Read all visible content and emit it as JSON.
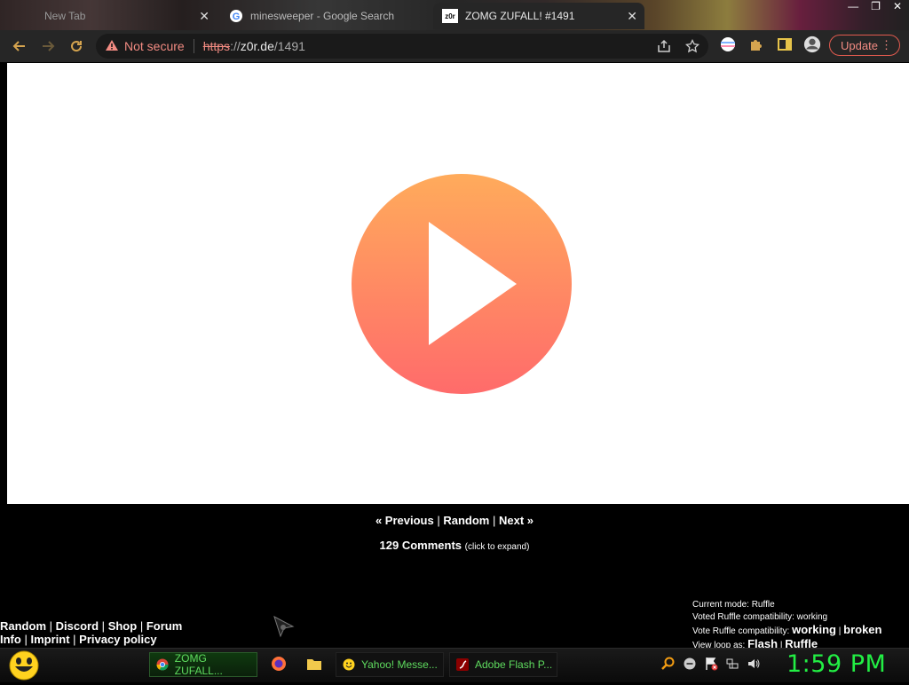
{
  "browser": {
    "tabs": [
      {
        "title": "New Tab",
        "active": false
      },
      {
        "title": "minesweeper - Google Search",
        "active": false
      },
      {
        "title": "ZOMG ZUFALL! #1491",
        "active": true
      }
    ],
    "new_tab_close": "×",
    "security_label": "Not secure",
    "url_scheme": "https",
    "url_rest": "://z0r.de/1491",
    "url_host": "z0r.de",
    "url_path": "/1491",
    "update_label": "Update",
    "favicon_text": "z0r"
  },
  "page": {
    "nav": {
      "previous": "« Previous",
      "random": "Random",
      "next": "Next »",
      "sep": "|"
    },
    "comments": {
      "count": "129 Comments",
      "hint": "(click to expand)"
    },
    "footer_row1": [
      "Random",
      "Discord",
      "Shop",
      "Forum"
    ],
    "footer_row2": [
      "Info",
      "Imprint",
      "Privacy policy"
    ],
    "mode": {
      "current": "Current mode: Ruffle",
      "voted": "Voted Ruffle compatibility: working",
      "vote_label": "Vote Ruffle compatibility:",
      "vote_working": "working",
      "vote_broken": "broken",
      "loop_label": "View loop as:",
      "loop_flash": "Flash",
      "loop_ruffle": "Ruffle"
    }
  },
  "taskbar": {
    "apps": [
      {
        "label": "ZOMG ZUFALL...",
        "icon": "chrome-icon",
        "active": true
      },
      {
        "label": "Yahoo! Messe...",
        "icon": "yahoo-messenger-icon",
        "active": false
      },
      {
        "label": "Adobe Flash P...",
        "icon": "flash-icon",
        "active": false
      }
    ],
    "clock": "1:59 PM"
  },
  "colors": {
    "play_top": "#ffab5b",
    "play_bottom": "#ff6b6b",
    "clock": "#22ee44",
    "taskbar_text": "#5fdc5f",
    "warning": "#f28b82"
  }
}
